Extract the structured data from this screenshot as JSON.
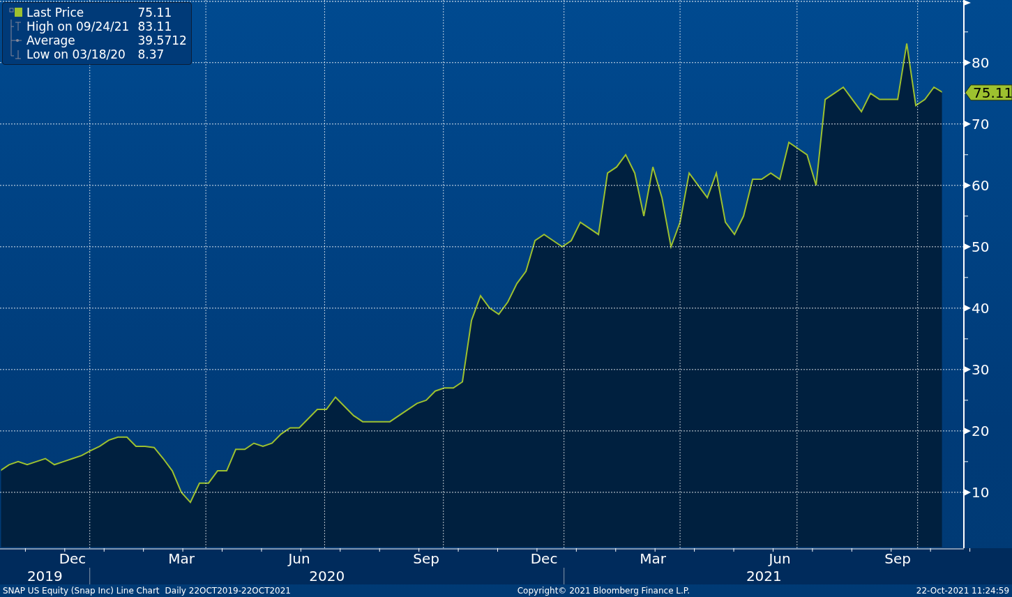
{
  "legend": {
    "items": [
      {
        "kind": "series",
        "value": "75.11"
      },
      {
        "kind": "high",
        "label": "High on 09/24/21",
        "value": "83.11"
      },
      {
        "kind": "average",
        "label": "Average",
        "value": "39.5712"
      },
      {
        "kind": "low",
        "label": "Low on 03/18/20",
        "value": "8.37"
      }
    ]
  },
  "chart": {
    "price_tag": "75.11",
    "years": [
      "2019",
      "2020",
      "2021"
    ],
    "chart_data": {
      "type": "area",
      "grid": true,
      "ylim": [
        0.9,
        90.2
      ],
      "yticks": [
        10,
        20,
        30,
        40,
        50,
        60,
        70,
        80
      ],
      "categories": [
        null,
        null,
        null,
        null,
        null,
        null,
        null,
        null,
        "Dec",
        null,
        null,
        null,
        null,
        null,
        null,
        null,
        null,
        null,
        null,
        null,
        "Mar",
        null,
        null,
        null,
        null,
        null,
        null,
        null,
        null,
        null,
        null,
        null,
        null,
        "Jun",
        null,
        null,
        null,
        null,
        null,
        null,
        null,
        null,
        null,
        null,
        null,
        null,
        null,
        "Sep",
        null,
        null,
        null,
        null,
        null,
        null,
        null,
        null,
        null,
        null,
        null,
        null,
        "Dec",
        null,
        null,
        null,
        null,
        null,
        null,
        null,
        null,
        null,
        null,
        null,
        "Mar",
        null,
        null,
        null,
        null,
        null,
        null,
        null,
        null,
        null,
        null,
        null,
        null,
        null,
        "Jun",
        null,
        null,
        null,
        null,
        null,
        null,
        null,
        null,
        null,
        null,
        null,
        null,
        "Sep",
        null,
        null,
        null,
        null,
        null
      ],
      "series": [
        {
          "name": "Last Price",
          "color": "#9dc12f",
          "values": [
            13.5,
            14.5,
            15,
            14.5,
            15,
            15.5,
            14.5,
            15,
            15.5,
            16,
            16.8,
            17.5,
            18.5,
            19,
            19,
            17.5,
            17.5,
            17.3,
            15.5,
            13.5,
            10,
            8.37,
            11.5,
            11.5,
            13.5,
            13.5,
            17,
            17,
            18,
            17.5,
            18,
            19.5,
            20.5,
            20.5,
            22,
            23.5,
            23.5,
            25.5,
            24,
            22.5,
            21.5,
            21.5,
            21.5,
            21.5,
            22.5,
            23.5,
            24.5,
            25,
            26.5,
            27,
            27,
            28,
            38,
            42,
            40,
            39,
            41,
            44,
            46,
            51,
            52,
            51,
            50,
            51,
            54,
            53,
            52,
            62,
            63,
            65,
            62,
            55,
            63,
            58,
            50,
            54,
            62,
            60,
            58,
            62,
            54,
            52,
            55,
            61,
            61,
            62,
            61,
            67,
            66,
            65,
            60,
            74,
            75,
            76,
            74,
            72,
            75,
            74,
            74,
            74,
            83.11,
            73,
            74,
            76,
            75.11
          ]
        }
      ]
    }
  },
  "footer": {
    "chart_title": "SNAP US Equity (Snap Inc) Line Chart",
    "period": "Daily 22OCT2019-22OCT2021",
    "copyright": "Copyright© 2021 Bloomberg Finance L.P.",
    "timestamp": "22-Oct-2021 11:24:59"
  }
}
